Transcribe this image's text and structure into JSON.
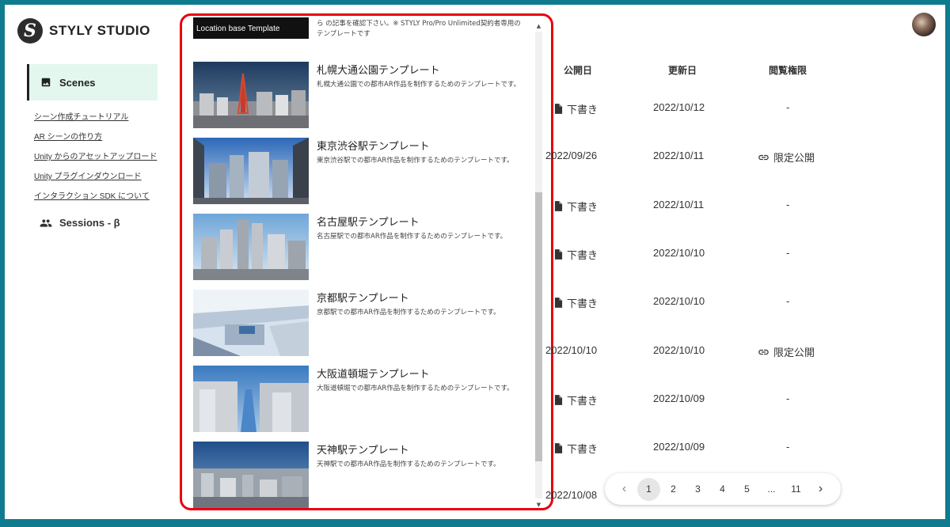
{
  "app": {
    "logo_mark": "S",
    "logo_text": "STYLY STUDIO"
  },
  "sidebar": {
    "scenes_label": "Scenes",
    "links": [
      "シーン作成チュートリアル",
      "AR シーンの作り方",
      "Unity からのアセットアップロード",
      "Unity プラグインダウンロード",
      "インタラクション SDK について"
    ],
    "sessions_label": "Sessions - β"
  },
  "table": {
    "headers": {
      "published": "公開日",
      "updated": "更新日",
      "access": "閲覧権限"
    },
    "rows": [
      {
        "published": "下書き",
        "updated": "2022/10/12",
        "access": "-"
      },
      {
        "published": "2022/09/26",
        "updated": "2022/10/11",
        "access": "限定公開"
      },
      {
        "published": "下書き",
        "updated": "2022/10/11",
        "access": "-"
      },
      {
        "published": "下書き",
        "updated": "2022/10/10",
        "access": "-"
      },
      {
        "published": "下書き",
        "updated": "2022/10/10",
        "access": "-"
      },
      {
        "published": "2022/10/10",
        "updated": "2022/10/10",
        "access": "限定公開"
      },
      {
        "published": "下書き",
        "updated": "2022/10/09",
        "access": "-"
      },
      {
        "published": "下書き",
        "updated": "2022/10/09",
        "access": "-"
      },
      {
        "published": "2022/10/08",
        "updated": "",
        "access": ""
      }
    ]
  },
  "pagination": {
    "prev": "‹",
    "pages": [
      "1",
      "2",
      "3",
      "4",
      "5",
      "...",
      "11"
    ],
    "current": "1",
    "next": "›"
  },
  "templates_panel": {
    "first": {
      "thumb_label": "Location base Template",
      "desc": "ら の記事を確認下さい。※ STYLY Pro/Pro Unlimited契約者専用のテンプレートです"
    },
    "items": [
      {
        "title": "札幌大通公園テンプレート",
        "desc": "札幌大通公園での都市AR作品を制作するためのテンプレートです。"
      },
      {
        "title": "東京渋谷駅テンプレート",
        "desc": "東京渋谷駅での都市AR作品を制作するためのテンプレートです。"
      },
      {
        "title": "名古屋駅テンプレート",
        "desc": "名古屋駅での都市AR作品を制作するためのテンプレートです。"
      },
      {
        "title": "京都駅テンプレート",
        "desc": "京都駅での都市AR作品を制作するためのテンプレートです。"
      },
      {
        "title": "大阪道頓堀テンプレート",
        "desc": "大阪道頓堀での都市AR作品を制作するためのテンプレートです。"
      },
      {
        "title": "天神駅テンプレート",
        "desc": "天神駅での都市AR作品を制作するためのテンプレートです。"
      }
    ]
  },
  "colors": {
    "frame": "#0f7b8e",
    "highlight_border": "#e8000e",
    "nav_active_bg": "#e3f7ee"
  }
}
